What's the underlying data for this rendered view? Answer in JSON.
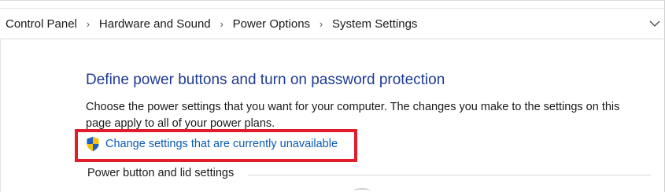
{
  "breadcrumb": {
    "items": [
      {
        "label": "Control Panel"
      },
      {
        "label": "Hardware and Sound"
      },
      {
        "label": "Power Options"
      },
      {
        "label": "System Settings"
      }
    ],
    "separator": "›",
    "dropdown_icon": "chevron-down-icon"
  },
  "main": {
    "heading": "Define power buttons and turn on password protection",
    "description": "Choose the power settings that you want for your computer. The changes you make to the settings on this page apply to all of your power plans.",
    "change_settings_link": "Change settings that are currently unavailable",
    "change_settings_icon": "uac-shield-icon",
    "section_title": "Power button and lid settings"
  },
  "colors": {
    "heading": "#1e3b96",
    "link": "#0b5bb5",
    "highlight_box": "#e21d2b"
  }
}
